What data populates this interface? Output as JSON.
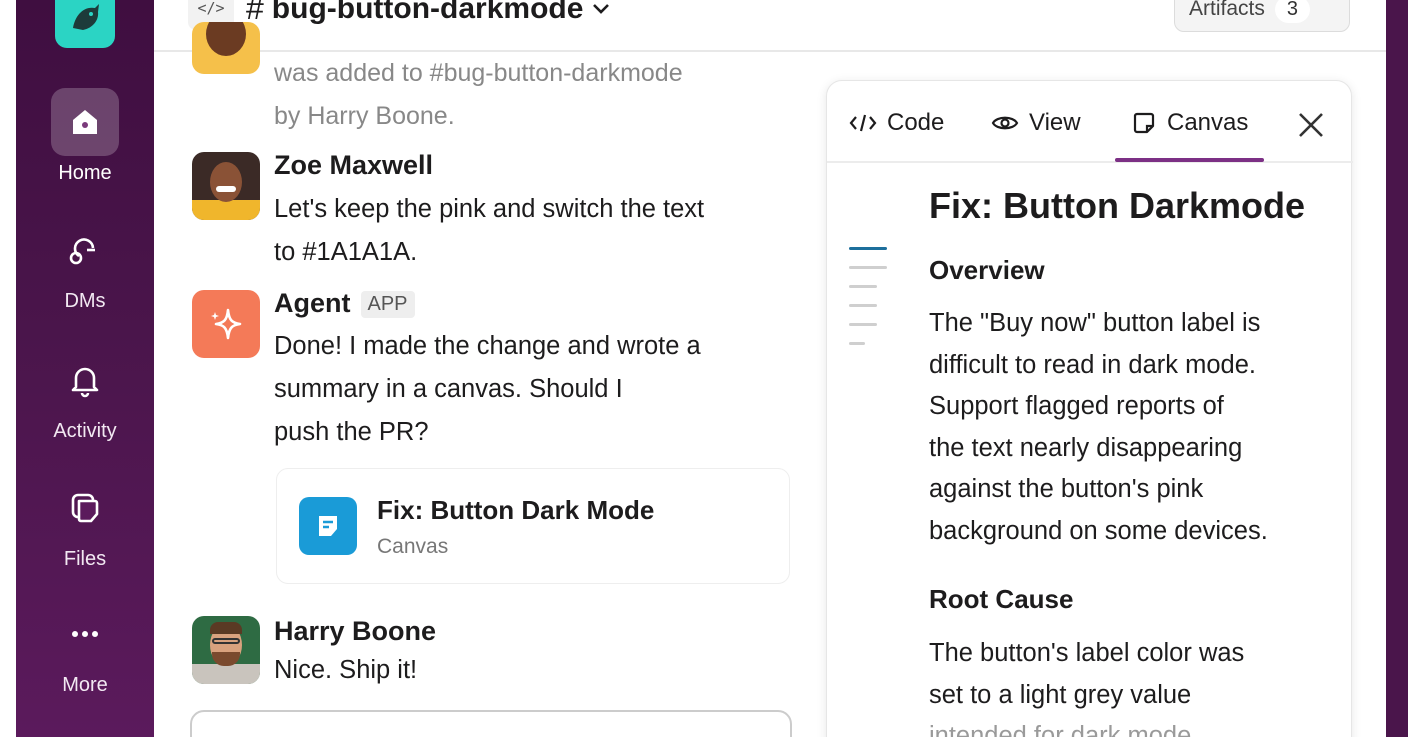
{
  "sidebar": {
    "items": [
      {
        "label": "Home",
        "icon": "home-icon"
      },
      {
        "label": "DMs",
        "icon": "dms-icon"
      },
      {
        "label": "Activity",
        "icon": "bell-icon"
      },
      {
        "label": "Files",
        "icon": "files-icon"
      },
      {
        "label": "More",
        "icon": "more-icon"
      }
    ]
  },
  "header": {
    "channel_name": "bug-button-darkmode",
    "artifacts_label": "Artifacts",
    "artifacts_count": "3"
  },
  "messages": {
    "system_line1": "was added to #bug-button-darkmode",
    "system_line2": "by Harry Boone.",
    "zoe": {
      "name": "Zoe Maxwell",
      "line1": "Let's keep the pink and switch the text",
      "line2": "to #1A1A1A."
    },
    "agent": {
      "name": "Agent",
      "badge": "APP",
      "line1": "Done! I made the change and wrote a",
      "line2": "summary in a canvas. Should I",
      "line3": "push the PR?"
    },
    "canvas_card": {
      "title": "Fix: Button Dark Mode",
      "subtitle": "Canvas"
    },
    "harry": {
      "name": "Harry Boone",
      "text": "Nice. Ship it!"
    }
  },
  "panel": {
    "tabs": [
      {
        "label": "Code",
        "icon": "code-icon"
      },
      {
        "label": "View",
        "icon": "eye-icon"
      },
      {
        "label": "Canvas",
        "icon": "canvas-icon"
      }
    ],
    "active_tab": "Canvas",
    "title": "Fix: Button Darkmode",
    "overview_heading": "Overview",
    "overview_lines": [
      "The \"Buy now\" button label is",
      "difficult to read in dark mode.",
      "Support flagged reports of",
      "the text nearly disappearing",
      "against the button's pink",
      "background on some devices."
    ],
    "root_cause_heading": "Root Cause",
    "root_cause_lines": [
      "The button's label color was",
      "set to a light grey value",
      "intended for dark mode"
    ]
  },
  "colors": {
    "sidebar_bg": "#4a154b",
    "tab_underline": "#7c3085",
    "agent_avatar": "#f47a58",
    "canvas_icon": "#1a9bd7",
    "logo_bg": "#2bd4c4"
  }
}
